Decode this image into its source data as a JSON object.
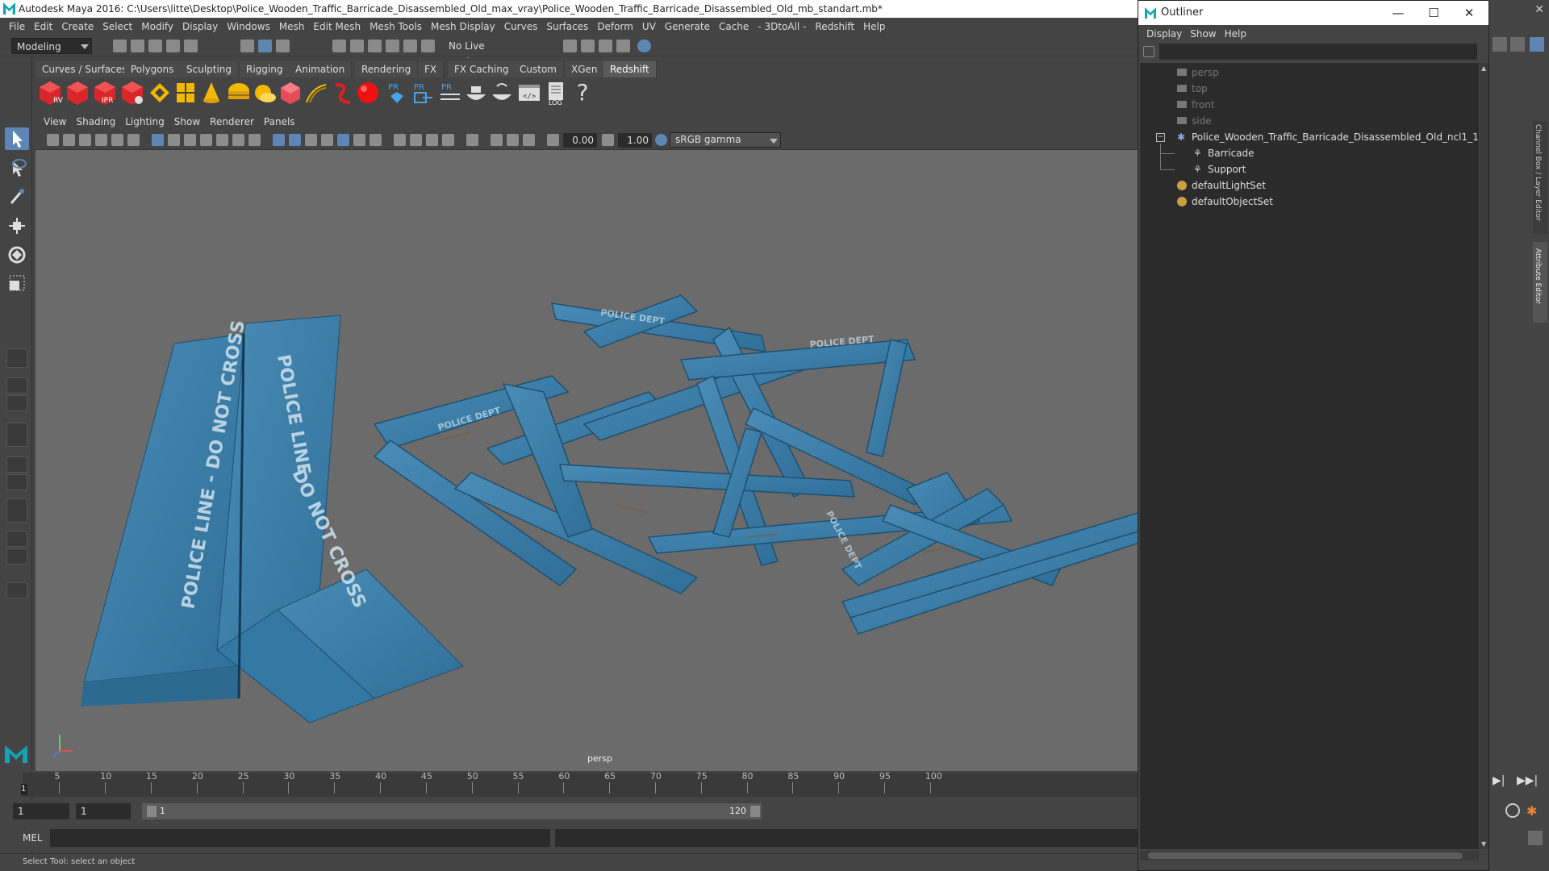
{
  "app": {
    "title": "Autodesk Maya 2016: C:\\Users\\litte\\Desktop\\Police_Wooden_Traffic_Barricade_Disassembled_Old_max_vray\\Police_Wooden_Traffic_Barricade_Disassembled_Old_mb_standart.mb*"
  },
  "window_controls": {
    "minimize": "—",
    "maximize": "☐",
    "close": "✕"
  },
  "menubar": [
    "File",
    "Edit",
    "Create",
    "Select",
    "Modify",
    "Display",
    "Windows",
    "Mesh",
    "Edit Mesh",
    "Mesh Tools",
    "Mesh Display",
    "Curves",
    "Surfaces",
    "Deform",
    "UV",
    "Generate",
    "Cache",
    "- 3DtoAll -",
    "Redshift",
    "Help"
  ],
  "statusline": {
    "mode": "Modeling",
    "live_surface": "No Live Surface"
  },
  "shelf_tabs": [
    "Curves / Surfaces",
    "Polygons",
    "Sculpting",
    "Rigging",
    "Animation",
    "Rendering",
    "FX",
    "FX Caching",
    "Custom",
    "XGen",
    "Redshift"
  ],
  "shelf_active": "Redshift",
  "shelf_icons": {
    "rv": "RV",
    "ipr": "IPR",
    "pr": "PR",
    "log": "LOG",
    "help": "?"
  },
  "viewport": {
    "menu": [
      "View",
      "Shading",
      "Lighting",
      "Show",
      "Renderer",
      "Panels"
    ],
    "exposure": "0.00",
    "gamma": "1.00",
    "colorspace": "sRGB gamma",
    "camera_label": "persp",
    "props": {
      "label1": "POLICE LINE - DO NOT CROSS",
      "label2": "POLICE LINE",
      "label3": "DO NOT CROSS",
      "dept": "POLICE DEPT"
    }
  },
  "timeline": {
    "ticks": [
      "5",
      "10",
      "15",
      "20",
      "25",
      "30",
      "35",
      "40",
      "45",
      "50",
      "55",
      "60",
      "65",
      "70",
      "75",
      "80",
      "85",
      "90",
      "95",
      "100"
    ],
    "current": "1"
  },
  "range": {
    "start": "1",
    "current": "1",
    "slider_start": "1",
    "slider_end": "120"
  },
  "cmd": {
    "label": "MEL"
  },
  "help": {
    "text": "Select Tool: select an object"
  },
  "outliner": {
    "title": "Outliner",
    "menu": [
      "Display",
      "Show",
      "Help"
    ],
    "items": [
      {
        "label": "persp",
        "dim": true
      },
      {
        "label": "top",
        "dim": true
      },
      {
        "label": "front",
        "dim": true
      },
      {
        "label": "side",
        "dim": true
      },
      {
        "label": "Police_Wooden_Traffic_Barricade_Disassembled_Old_ncl1_1",
        "dim": false
      },
      {
        "label": "Barricade",
        "dim": false
      },
      {
        "label": "Support",
        "dim": false
      },
      {
        "label": "defaultLightSet",
        "dim": false
      },
      {
        "label": "defaultObjectSet",
        "dim": false
      }
    ]
  },
  "side_tabs": {
    "channel_box": "Channel Box / Layer Editor",
    "attribute_editor": "Attribute Editor"
  },
  "colors": {
    "accent": "#5d86b5",
    "prop": "#3d7fa8",
    "viewport_bg": "#6b6b6b"
  }
}
